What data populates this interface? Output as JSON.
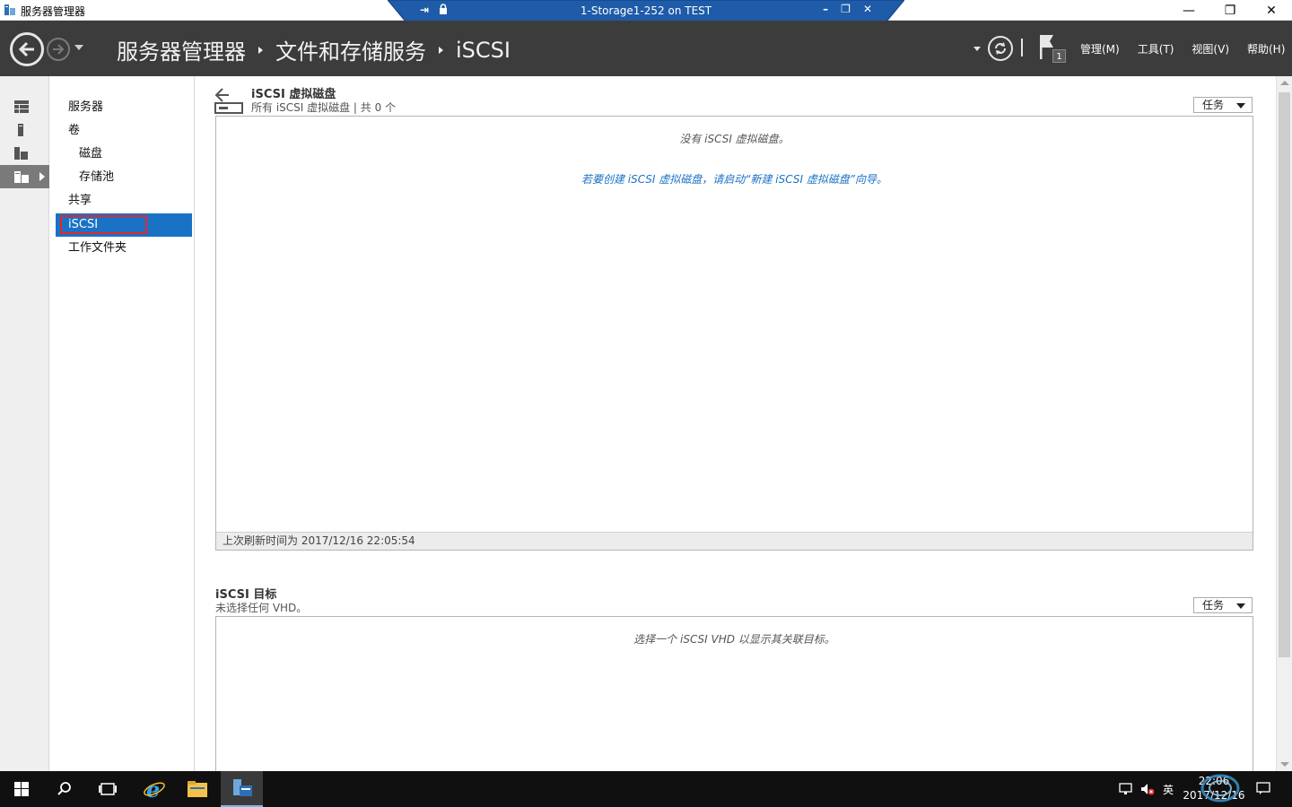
{
  "window": {
    "title": "服务器管理器",
    "minimize": "—",
    "restore": "❐",
    "close": "✕"
  },
  "rdp": {
    "title": "1-Storage1-252 on TEST",
    "pin": "⇥",
    "minimize": "–",
    "restore": "❐",
    "close": "✕"
  },
  "breadcrumb": [
    "服务器管理器",
    "文件和存储服务",
    "iSCSI"
  ],
  "menus": {
    "manage": "管理(M)",
    "tools": "工具(T)",
    "view": "视图(V)",
    "help": "帮助(H)"
  },
  "flag_count": "1",
  "nav": {
    "servers": "服务器",
    "volumes": "卷",
    "disks": "磁盘",
    "pools": "存储池",
    "shares": "共享",
    "iscsi": "iSCSI",
    "workfolders": "工作文件夹"
  },
  "vdisk_section": {
    "title": "iSCSI 虚拟磁盘",
    "subtitle": "所有 iSCSI 虚拟磁盘 | 共 0 个",
    "tasks": "任务",
    "empty_msg": "没有 iSCSI 虚拟磁盘。",
    "create_msg": "若要创建 iSCSI 虚拟磁盘，请启动“新建 iSCSI 虚拟磁盘”向导。",
    "footer": "上次刷新时间为 2017/12/16 22:05:54"
  },
  "target_section": {
    "title": "iSCSI 目标",
    "subtitle": "未选择任何 VHD。",
    "tasks": "任务",
    "empty_msg": "选择一个 iSCSI VHD 以显示其关联目标。"
  },
  "tray": {
    "ime": "英",
    "time": "22:06",
    "date": "2017/12/16"
  },
  "colors": {
    "header_bg": "#3c3c3c",
    "selection": "#1a72c4",
    "highlight_box": "#e5252a",
    "rdp_bar": "#1e5ba8"
  }
}
